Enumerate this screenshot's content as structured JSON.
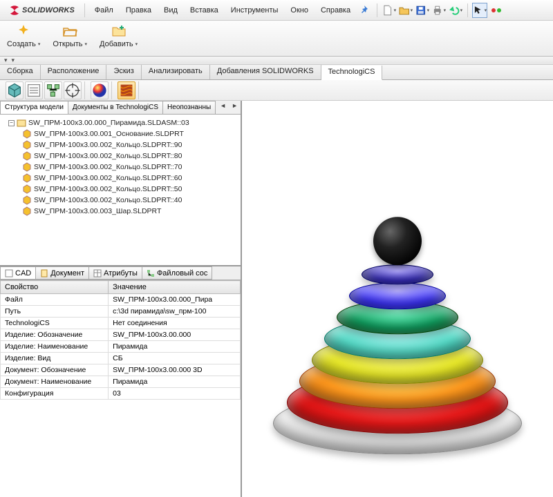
{
  "app": {
    "brand": "SOLIDWORKS"
  },
  "menu": {
    "file": "Файл",
    "edit": "Правка",
    "view": "Вид",
    "insert": "Вставка",
    "tools": "Инструменты",
    "window": "Окно",
    "help": "Справка"
  },
  "cmd": {
    "create": "Создать",
    "open": "Открыть",
    "add": "Добавить"
  },
  "ribbon": {
    "tabs": [
      "Сборка",
      "Расположение",
      "Эскиз",
      "Анализировать",
      "Добавления SOLIDWORKS",
      "TechnologiCS"
    ],
    "active_index": 5
  },
  "subtabs": {
    "items": [
      "Структура модели",
      "Документы в TechnologiCS",
      "Неопознанны"
    ],
    "active_index": 0
  },
  "tree": {
    "root": "SW_ПРМ-100x3.00.000_Пирамида.SLDASM::03",
    "children": [
      "SW_ПРМ-100x3.00.001_Основание.SLDPRT",
      "SW_ПРМ-100x3.00.002_Кольцо.SLDPRT::90",
      "SW_ПРМ-100x3.00.002_Кольцо.SLDPRT::80",
      "SW_ПРМ-100x3.00.002_Кольцо.SLDPRT::70",
      "SW_ПРМ-100x3.00.002_Кольцо.SLDPRT::60",
      "SW_ПРМ-100x3.00.002_Кольцо.SLDPRT::50",
      "SW_ПРМ-100x3.00.002_Кольцо.SLDPRT::40",
      "SW_ПРМ-100x3.00.003_Шар.SLDPRT"
    ]
  },
  "proptabs": {
    "items": [
      "CAD",
      "Документ",
      "Атрибуты",
      "Файловый сос"
    ],
    "active_index": 0
  },
  "prop_header": {
    "key": "Свойство",
    "val": "Значение"
  },
  "props": [
    {
      "k": "Файл",
      "v": "SW_ПРМ-100x3.00.000_Пира"
    },
    {
      "k": "Путь",
      "v": "c:\\3d пирамида\\sw_прм-100"
    },
    {
      "k": "TechnologiCS",
      "v": "Нет соединения"
    },
    {
      "k": "Изделие: Обозначение",
      "v": "SW_ПРМ-100x3.00.000"
    },
    {
      "k": "Изделие: Наименование",
      "v": "Пирамида"
    },
    {
      "k": "Изделие: Вид",
      "v": "СБ"
    },
    {
      "k": "Документ: Обозначение",
      "v": "SW_ПРМ-100x3.00.000 3D"
    },
    {
      "k": "Документ: Наименование",
      "v": "Пирамида"
    },
    {
      "k": "Конфигурация",
      "v": "03"
    }
  ],
  "pyramid": {
    "sphere_color": "#111111",
    "rings": [
      {
        "color": "#2a1ec0",
        "name": "ring-90"
      },
      {
        "color": "#3a30ff",
        "name": "ring-80"
      },
      {
        "color": "#10a060",
        "name": "ring-70"
      },
      {
        "color": "#57dcc9",
        "name": "ring-60"
      },
      {
        "color": "#e8e82a",
        "name": "ring-50"
      },
      {
        "color": "#ff9a1f",
        "name": "ring-40"
      },
      {
        "color": "#e81a1a",
        "name": "ring-base-ring"
      }
    ]
  }
}
